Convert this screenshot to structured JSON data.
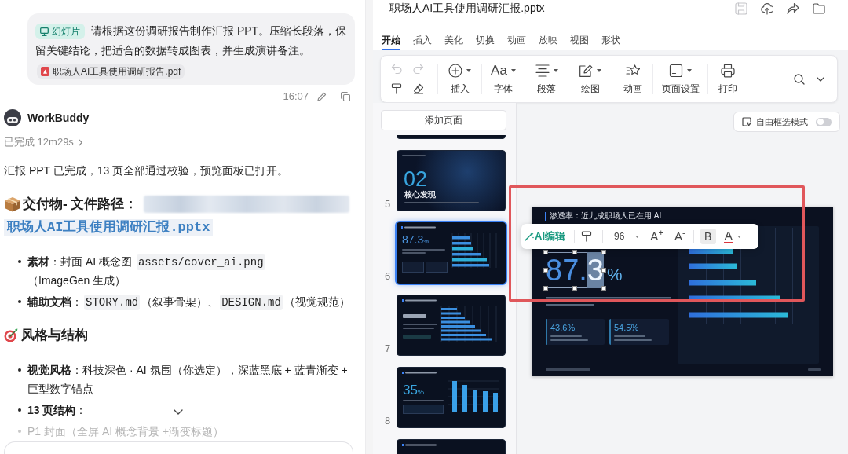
{
  "chat": {
    "user_message": {
      "tag": "幻灯片",
      "text": "请根据这份调研报告制作汇报 PPT。压缩长段落，保留关键结论，把适合的数据转成图表，并生成演讲备注。",
      "attachment": "职场人AI工具使用调研报告.pdf",
      "time": "16:07"
    },
    "assistant": {
      "name": "WorkBuddy",
      "status": "已完成 12m29s",
      "summary": "汇报 PPT 已完成，13 页全部通过校验，预览面板已打开。",
      "sections": [
        {
          "kind": "deliverable",
          "heading": "交付物- 文件路径：",
          "path_blurred": true,
          "file_link": "职场人AI工具使用调研汇报.pptx",
          "bullets": [
            {
              "faded": false,
              "segments": [
                {
                  "kind": "text",
                  "text": "**素材**：封面 AI 概念图 "
                },
                {
                  "kind": "code",
                  "text": "assets/cover_ai.png"
                },
                {
                  "kind": "text",
                  "text": "（ImageGen 生成）"
                }
              ]
            },
            {
              "faded": false,
              "segments": [
                {
                  "kind": "text",
                  "text": "**辅助文档**："
                },
                {
                  "kind": "code",
                  "text": "STORY.md"
                },
                {
                  "kind": "text",
                  "text": "（叙事骨架）、"
                },
                {
                  "kind": "code",
                  "text": "DESIGN.md"
                },
                {
                  "kind": "text",
                  "text": "（视觉规范）"
                }
              ]
            }
          ]
        },
        {
          "kind": "style",
          "heading": "风格与结构",
          "bullets": [
            {
              "faded": false,
              "segments": [
                {
                  "kind": "text",
                  "text": "**视觉风格**：科技深色 · AI 氛围（你选定），深蓝黑底 + 蓝青渐变 + 巨型数字锚点"
                }
              ]
            },
            {
              "faded": false,
              "segments": [
                {
                  "kind": "text",
                  "text": "**13 页结构**："
                }
              ]
            },
            {
              "faded": true,
              "segments": [
                {
                  "kind": "text",
                  "text": "P1 封面（全屏 AI 概念背景 +渐变标题）"
                }
              ]
            }
          ]
        }
      ]
    }
  },
  "editor": {
    "document_title": "职场人AI工具使用调研汇报.pptx",
    "title_actions": [
      {
        "kind": "save",
        "disabled": true
      },
      {
        "kind": "upload",
        "disabled": false
      },
      {
        "kind": "share",
        "disabled": false
      },
      {
        "kind": "folder",
        "disabled": false
      }
    ],
    "tabs": [
      {
        "label": "开始",
        "selected": true
      },
      {
        "label": "插入",
        "selected": false
      },
      {
        "label": "美化",
        "selected": false
      },
      {
        "label": "切换",
        "selected": false
      },
      {
        "label": "动画",
        "selected": false
      },
      {
        "label": "放映",
        "selected": false
      },
      {
        "label": "视图",
        "selected": false
      },
      {
        "label": "形状",
        "selected": false
      }
    ],
    "ribbon": {
      "history": [
        {
          "kind": "undo",
          "disabled": true
        },
        {
          "kind": "redo",
          "disabled": true
        },
        {
          "kind": "format_painter",
          "disabled": false
        },
        {
          "kind": "eraser",
          "disabled": false
        }
      ],
      "tools": [
        {
          "kind": "insert",
          "label": "插入",
          "has_menu": true
        },
        {
          "kind": "font",
          "glyph": "Aa",
          "label": "字体",
          "has_menu": true
        },
        {
          "kind": "paragraph",
          "label": "段落",
          "has_menu": true
        },
        {
          "kind": "draw",
          "label": "绘图",
          "has_menu": true
        },
        {
          "kind": "animation",
          "label": "动画",
          "has_menu": false
        },
        {
          "kind": "page_setup",
          "label": "页面设置",
          "has_menu": true
        },
        {
          "kind": "print",
          "label": "打印",
          "has_menu": false
        }
      ]
    },
    "add_page_button": "添加页面",
    "thumbnails": [
      {
        "kind": "cut_top",
        "selected": false
      },
      {
        "kind": "section",
        "number": "5",
        "selected": false,
        "big_text": "02",
        "caption": "核心发现"
      },
      {
        "kind": "stat_bars",
        "number": "6",
        "selected": true,
        "big_text": "87.3",
        "unit": "%"
      },
      {
        "kind": "bars",
        "number": "7",
        "selected": false
      },
      {
        "kind": "stat_columns",
        "number": "8",
        "selected": false,
        "big_text": "35",
        "unit": "%"
      },
      {
        "kind": "cut_bottom",
        "selected": false
      }
    ],
    "selection_mode": {
      "label": "自由框选模式",
      "on": false
    },
    "slide": {
      "title": "渗透率：近九成职场人已在用 AI",
      "headline": {
        "parts": [
          {
            "text": "87.",
            "selected": false
          },
          {
            "text": "3",
            "selected": true
          }
        ],
        "unit": "%"
      },
      "stats": [
        {
          "value": "43.6%"
        },
        {
          "value": "54.5%"
        }
      ]
    },
    "format_bar": {
      "ai_edit": "AI编辑",
      "font_size": "96",
      "grow": "A$^{+}$",
      "shrink": "A$^{-}$",
      "bold": "B",
      "font_color": "A"
    }
  }
}
